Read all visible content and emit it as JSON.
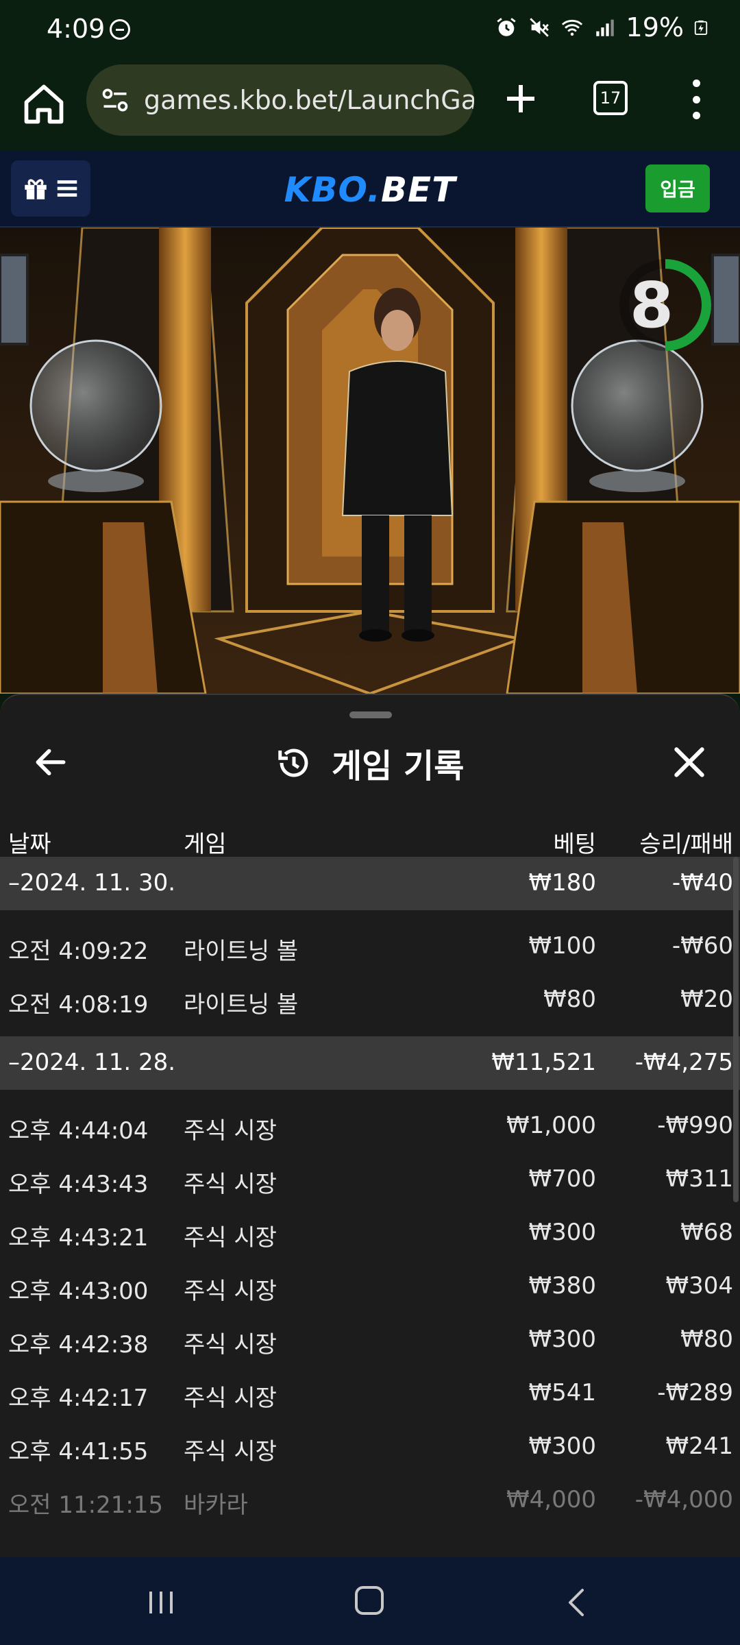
{
  "status_bar": {
    "time": "4:09",
    "battery": "19%",
    "icons": [
      "do-not-disturb-icon",
      "alarm-icon",
      "mute-icon",
      "wifi-icon",
      "signal-icon",
      "battery-charging-icon"
    ]
  },
  "browser": {
    "url": "games.kbo.bet/LaunchGar",
    "tab_count": "17"
  },
  "site": {
    "logo_part_a": "KBO.",
    "logo_part_b": "BET",
    "deposit_label": "입금",
    "brand_color": "#1f8bff",
    "deposit_color": "#1a9c2f"
  },
  "video": {
    "countdown": "8",
    "countdown_fraction": 0.5
  },
  "history": {
    "title": "게임 기록",
    "columns": {
      "date": "날짜",
      "game": "게임",
      "bet": "베팅",
      "result": "승리/패배"
    },
    "groups": [
      {
        "date": "–2024. 11. 30.",
        "bet": "₩180",
        "result": "-₩40",
        "rows": [
          {
            "time": "오전 4:09:22",
            "game": "라이트닝 볼",
            "bet": "₩100",
            "result": "-₩60"
          },
          {
            "time": "오전 4:08:19",
            "game": "라이트닝 볼",
            "bet": "₩80",
            "result": "₩20"
          }
        ]
      },
      {
        "date": "–2024. 11. 28.",
        "bet": "₩11,521",
        "result": "-₩4,275",
        "rows": [
          {
            "time": "오후 4:44:04",
            "game": "주식 시장",
            "bet": "₩1,000",
            "result": "-₩990"
          },
          {
            "time": "오후 4:43:43",
            "game": "주식 시장",
            "bet": "₩700",
            "result": "₩311"
          },
          {
            "time": "오후 4:43:21",
            "game": "주식 시장",
            "bet": "₩300",
            "result": "₩68"
          },
          {
            "time": "오후 4:43:00",
            "game": "주식 시장",
            "bet": "₩380",
            "result": "₩304"
          },
          {
            "time": "오후 4:42:38",
            "game": "주식 시장",
            "bet": "₩300",
            "result": "₩80"
          },
          {
            "time": "오후 4:42:17",
            "game": "주식 시장",
            "bet": "₩541",
            "result": "-₩289"
          },
          {
            "time": "오후 4:41:55",
            "game": "주식 시장",
            "bet": "₩300",
            "result": "₩241"
          },
          {
            "time": "오전 11:21:15",
            "game": "바카라",
            "bet": "₩4,000",
            "result": "-₩4,000"
          }
        ]
      }
    ]
  }
}
